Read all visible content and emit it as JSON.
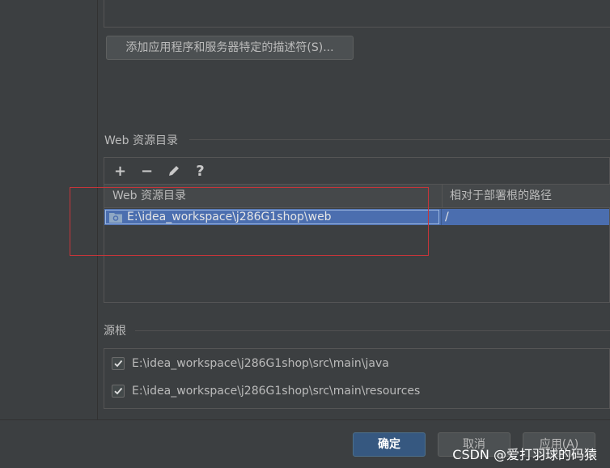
{
  "descriptor_button_label": "添加应用程序和服务器特定的描述符(S)...",
  "web_resources": {
    "section_title": "Web 资源目录",
    "toolbar": {
      "add": "+",
      "remove": "−",
      "help": "?"
    },
    "columns": [
      "Web 资源目录",
      "相对于部署根的路径"
    ],
    "rows": [
      {
        "directory": "E:\\idea_workspace\\j286G1shop\\web",
        "path": "/"
      }
    ]
  },
  "source_roots": {
    "section_title": "源根",
    "items": [
      {
        "path": "E:\\idea_workspace\\j286G1shop\\src\\main\\java",
        "checked": true
      },
      {
        "path": "E:\\idea_workspace\\j286G1shop\\src\\main\\resources",
        "checked": true
      }
    ]
  },
  "footer": {
    "ok": "确定",
    "cancel": "取消",
    "apply": "应用(A)"
  },
  "watermark": "CSDN @爱打羽球的码猿",
  "colors": {
    "background": "#3c3f41",
    "selection": "#4b6eaf",
    "primary_button": "#365880",
    "highlight_box": "#c7353a"
  },
  "icons": [
    "plus-icon",
    "minus-icon",
    "pencil-icon",
    "question-icon",
    "folder-icon",
    "checkmark-icon"
  ]
}
